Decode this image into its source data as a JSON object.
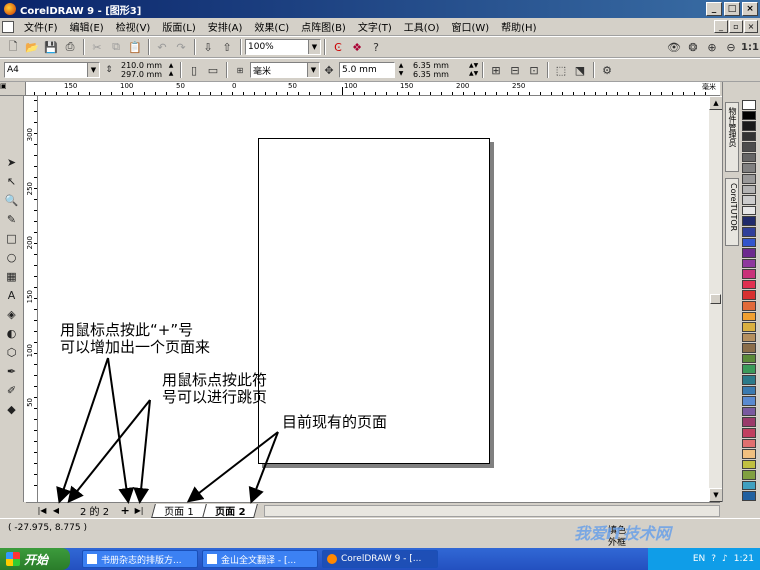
{
  "window": {
    "title": "CorelDRAW 9 - [图形3]"
  },
  "menu": [
    "文件(F)",
    "编辑(E)",
    "检视(V)",
    "版面(L)",
    "安排(A)",
    "效果(C)",
    "点阵图(B)",
    "文字(T)",
    "工具(O)",
    "窗口(W)",
    "帮助(H)"
  ],
  "toolbar": {
    "zoom": "100%"
  },
  "propbar": {
    "paper": "A4",
    "width": "210.0 mm",
    "height": "297.0 mm",
    "units": "毫米",
    "nudge": "5.0 mm",
    "dup_x": "6.35 mm",
    "dup_y": "6.35 mm"
  },
  "ruler": {
    "h_labels": [
      "150",
      "100",
      "50",
      "0",
      "50",
      "100",
      "150",
      "200",
      "250"
    ],
    "h_unit": "毫米",
    "v_labels": [
      "300",
      "250",
      "200",
      "150",
      "100",
      "50"
    ]
  },
  "docker": {
    "tab1": "物件管理员",
    "tab2": "CorelTUTOR"
  },
  "palette": [
    "#ffffff",
    "#000000",
    "#1a1a1a",
    "#333333",
    "#4d4d4d",
    "#666666",
    "#808080",
    "#999999",
    "#b3b3b3",
    "#cccccc",
    "#e6e6e6",
    "#1f2a6b",
    "#2f3f9a",
    "#3355cc",
    "#6c2a8e",
    "#8e3a9e",
    "#c8327a",
    "#e03050",
    "#d63030",
    "#e06a3a",
    "#f0a030",
    "#d9b040",
    "#b59060",
    "#8a6d4a",
    "#5a8a3a",
    "#3a9a5a",
    "#2a7a8a",
    "#3a7ab0",
    "#5a8ad0",
    "#7a5aa0",
    "#9a3a6a",
    "#c04060",
    "#e07070",
    "#f0c080",
    "#c0c040",
    "#80a040",
    "#40a0c0",
    "#2060a0"
  ],
  "pagebar": {
    "counter": "2 的 2",
    "tabs": [
      "页面 1",
      "页面 2"
    ]
  },
  "status": {
    "coords": "( -27.975, 8.775 )",
    "fill_label": "填色",
    "outline_label": "外框"
  },
  "taskbar": {
    "start": "开始",
    "tasks": [
      "书册杂志的排版方...",
      "金山全文翻译 - [...",
      "CorelDRAW 9 - [..."
    ],
    "lang": "EN",
    "time": "1:21"
  },
  "annotations": {
    "add_line1": "用鼠标点按此“+”号",
    "add_line2": "可以增加出一个页面来",
    "jump_line1": "用鼠标点按此符",
    "jump_line2": "号可以进行跳页",
    "current": "目前现有的页面"
  },
  "watermark": "我爱IT技术网"
}
